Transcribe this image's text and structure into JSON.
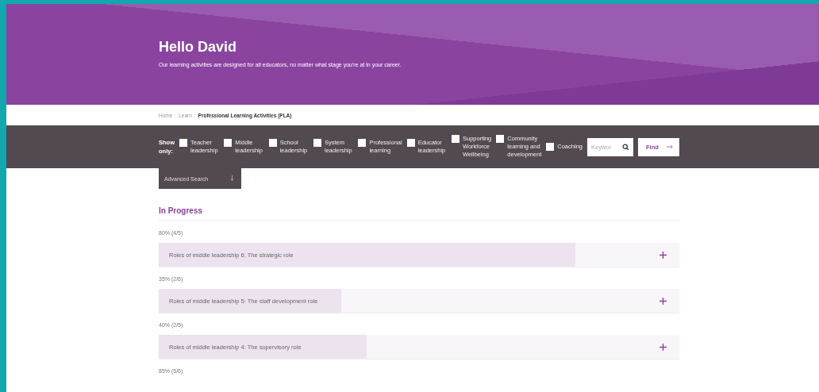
{
  "hero": {
    "title": "Hello David",
    "subtitle": "Our learning activities are designed for all educators, no matter what stage you're at in your career."
  },
  "breadcrumb": [
    {
      "label": "Home",
      "kind": "link"
    },
    {
      "label": ":",
      "kind": "sep"
    },
    {
      "label": "Learn",
      "kind": "link"
    },
    {
      "label": ":",
      "kind": "sep"
    },
    {
      "label": "Professional Learning Activities (PLA)",
      "kind": "current"
    }
  ],
  "filters": {
    "label": "Show only:",
    "options": [
      {
        "label": "Teacher leadership",
        "checked": false
      },
      {
        "label": "Middle leadership",
        "checked": false
      },
      {
        "label": "School leadership",
        "checked": false
      },
      {
        "label": "System leadership",
        "checked": false
      },
      {
        "label": "Professional learning",
        "checked": false
      },
      {
        "label": "Educator leadership",
        "checked": false
      },
      {
        "label": "Supporting Workforce Wellbeing",
        "checked": false
      },
      {
        "label": "Community learning and development",
        "checked": false
      },
      {
        "label": "Coaching",
        "checked": false
      }
    ],
    "search": {
      "placeholder": "Keywor"
    },
    "find_button": "Find",
    "advanced_search": "Advanced Search"
  },
  "section": {
    "title": "In Progress",
    "items": [
      {
        "progress": "80% (4/5)",
        "title": "Roles of middle leadership 6: The strategic role",
        "level": 0.8
      },
      {
        "progress": "35% (2/6)",
        "title": "Roles of middle leadership 5: The staff development role",
        "level": 0.35
      },
      {
        "progress": "40% (2/5)",
        "title": "Roles of middle leadership 4: The supervisory role",
        "level": 0.4
      },
      {
        "progress": "85% (5/6)"
      }
    ]
  }
}
